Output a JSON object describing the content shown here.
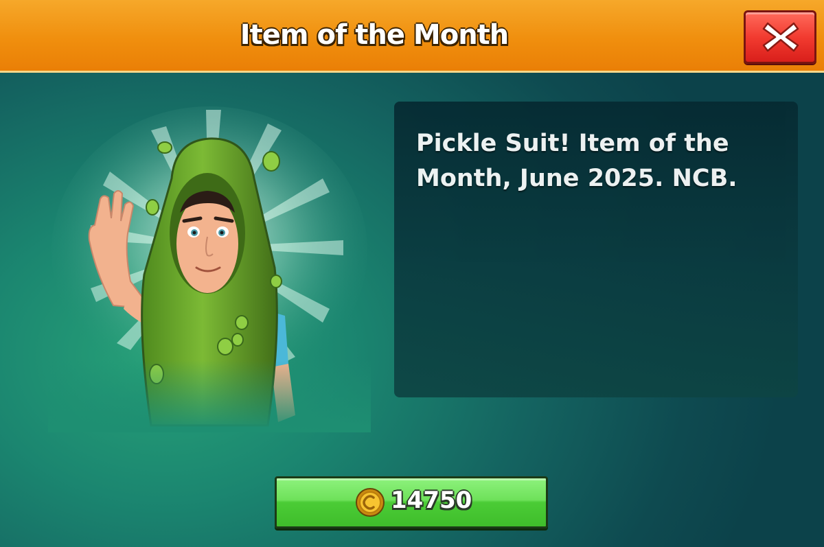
{
  "header": {
    "title": "Item of the Month",
    "close_icon": "close-x-icon"
  },
  "item": {
    "image_icon": "pickle-suit-character",
    "description": "Pickle Suit! Item of the Month, June 2025. NCB."
  },
  "purchase": {
    "currency_icon": "coin-icon",
    "price": "14750"
  },
  "colors": {
    "header": "#f08f0e",
    "close_button": "#f23b30",
    "buy_button": "#5ad646",
    "panel": "#073038",
    "background": "#176a64"
  }
}
